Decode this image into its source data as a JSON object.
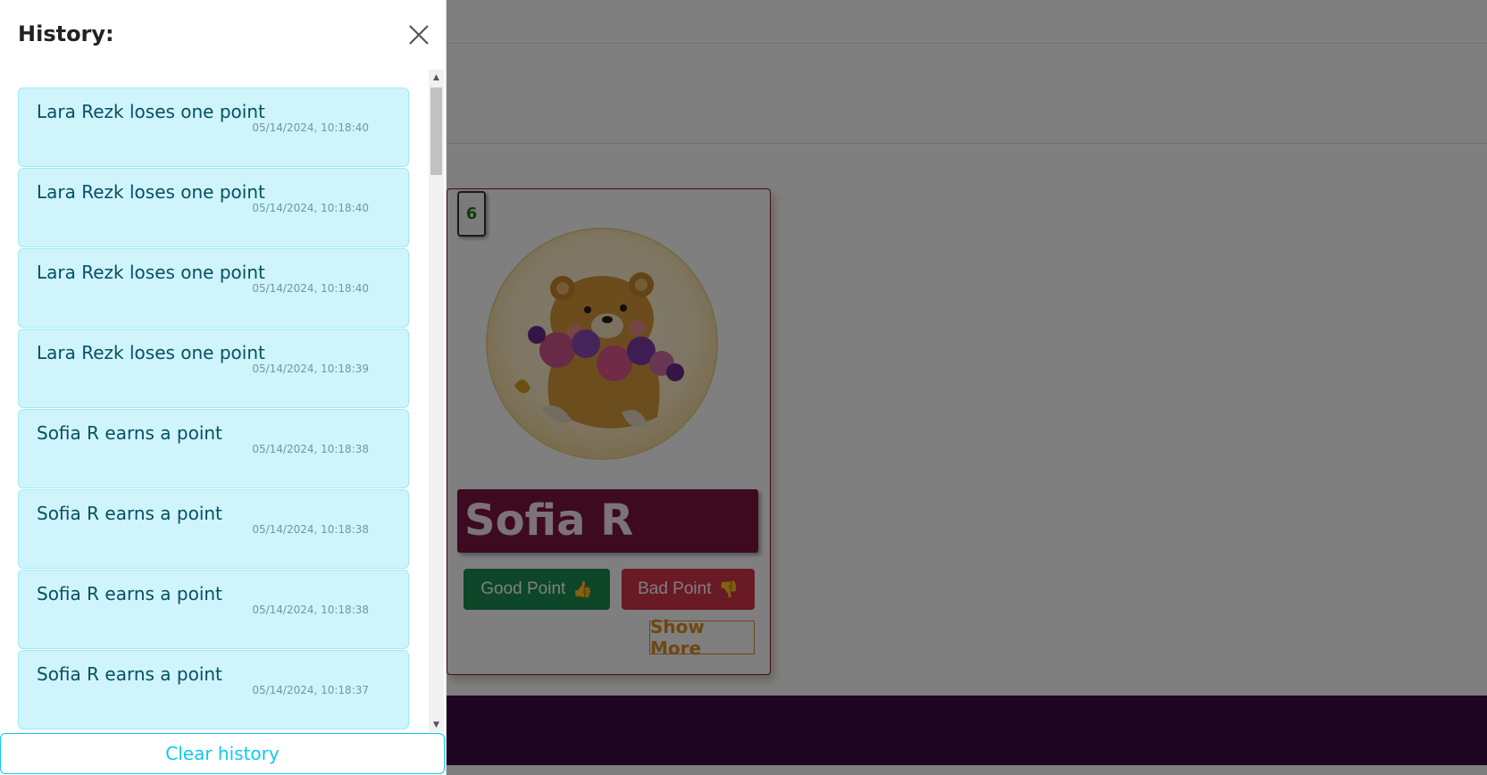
{
  "panel": {
    "title": "History:",
    "close_icon": "close-icon",
    "items": [
      {
        "text": "Lara Rezk loses one point",
        "time": "05/14/2024, 10:18:40"
      },
      {
        "text": "Lara Rezk loses one point",
        "time": "05/14/2024, 10:18:40"
      },
      {
        "text": "Lara Rezk loses one point",
        "time": "05/14/2024, 10:18:40"
      },
      {
        "text": "Lara Rezk loses one point",
        "time": "05/14/2024, 10:18:39"
      },
      {
        "text": "Sofia R earns a point",
        "time": "05/14/2024, 10:18:38"
      },
      {
        "text": "Sofia R earns a point",
        "time": "05/14/2024, 10:18:38"
      },
      {
        "text": "Sofia R earns a point",
        "time": "05/14/2024, 10:18:38"
      },
      {
        "text": "Sofia R earns a point",
        "time": "05/14/2024, 10:18:37"
      }
    ],
    "clear_label": "Clear history"
  },
  "card": {
    "score": "6",
    "name": "Sofia R",
    "good_label": "Good Point",
    "good_icon": "thumbs-up-icon",
    "bad_label": "Bad Point",
    "bad_icon": "thumbs-down-icon",
    "show_more_label": "Show More"
  },
  "colors": {
    "panel_item_bg": "#cff4fc",
    "panel_item_text": "#055160",
    "clear_accent": "#0dcaf0",
    "name_banner": "#7a1540",
    "good_btn": "#1a8d52",
    "bad_btn": "#d3344a",
    "footer": "#3d0a44"
  }
}
